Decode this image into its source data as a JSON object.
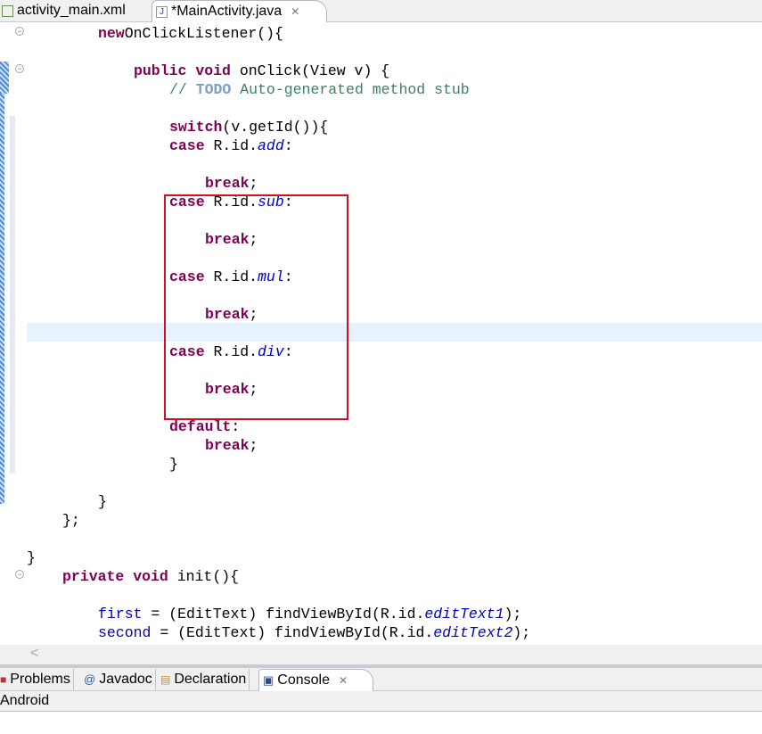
{
  "editor_tabs": [
    {
      "label": "activity_main.xml",
      "icon": "xml-file-icon"
    },
    {
      "label": "*MainActivity.java",
      "icon": "java-file-warning-icon",
      "active": true
    }
  ],
  "code_lines": [
    {
      "indent": 8,
      "tokens": [
        [
          "kw",
          "new"
        ],
        [
          "",
          "OnClickListener(){"
        ]
      ]
    },
    {
      "indent": 0,
      "tokens": []
    },
    {
      "indent": 12,
      "tokens": [
        [
          "kw",
          "public"
        ],
        [
          "",
          " "
        ],
        [
          "kw",
          "void"
        ],
        [
          "",
          " onClick(View v) {"
        ]
      ]
    },
    {
      "indent": 16,
      "tokens": [
        [
          "cm",
          "// "
        ],
        [
          "todo",
          "TODO"
        ],
        [
          "cm",
          " Auto-generated method stub"
        ]
      ]
    },
    {
      "indent": 0,
      "tokens": []
    },
    {
      "indent": 16,
      "tokens": [
        [
          "kw",
          "switch"
        ],
        [
          "",
          "(v.getId()){"
        ]
      ]
    },
    {
      "indent": 16,
      "tokens": [
        [
          "kw",
          "case"
        ],
        [
          "",
          " R.id."
        ],
        [
          "sfld",
          "add"
        ],
        [
          "",
          ":"
        ]
      ]
    },
    {
      "indent": 0,
      "tokens": []
    },
    {
      "indent": 20,
      "tokens": [
        [
          "kw",
          "break"
        ],
        [
          "",
          ";"
        ]
      ]
    },
    {
      "indent": 16,
      "tokens": [
        [
          "kw",
          "case"
        ],
        [
          "",
          " R.id."
        ],
        [
          "sfld",
          "sub"
        ],
        [
          "",
          ":"
        ]
      ]
    },
    {
      "indent": 0,
      "tokens": []
    },
    {
      "indent": 20,
      "tokens": [
        [
          "kw",
          "break"
        ],
        [
          "",
          ";"
        ]
      ]
    },
    {
      "indent": 0,
      "tokens": []
    },
    {
      "indent": 16,
      "tokens": [
        [
          "kw",
          "case"
        ],
        [
          "",
          " R.id."
        ],
        [
          "sfld",
          "mul"
        ],
        [
          "",
          ":"
        ]
      ]
    },
    {
      "indent": 0,
      "tokens": []
    },
    {
      "indent": 20,
      "tokens": [
        [
          "kw",
          "break"
        ],
        [
          "",
          ";"
        ]
      ]
    },
    {
      "indent": 0,
      "tokens": []
    },
    {
      "indent": 16,
      "tokens": [
        [
          "kw",
          "case"
        ],
        [
          "",
          " R.id."
        ],
        [
          "sfld",
          "div"
        ],
        [
          "",
          ":"
        ]
      ]
    },
    {
      "indent": 0,
      "tokens": []
    },
    {
      "indent": 20,
      "tokens": [
        [
          "kw",
          "break"
        ],
        [
          "",
          ";"
        ]
      ]
    },
    {
      "indent": 0,
      "tokens": []
    },
    {
      "indent": 16,
      "tokens": [
        [
          "kw",
          "default"
        ],
        [
          "",
          ":"
        ]
      ]
    },
    {
      "indent": 20,
      "tokens": [
        [
          "kw",
          "break"
        ],
        [
          "",
          ";"
        ]
      ]
    },
    {
      "indent": 16,
      "tokens": [
        [
          "",
          "}"
        ]
      ]
    },
    {
      "indent": 0,
      "tokens": []
    },
    {
      "indent": 8,
      "tokens": [
        [
          "",
          "}"
        ]
      ]
    },
    {
      "indent": 4,
      "tokens": [
        [
          "",
          "};"
        ]
      ]
    },
    {
      "indent": 0,
      "tokens": []
    },
    {
      "indent": 0,
      "tokens": [
        [
          "",
          "}"
        ]
      ]
    },
    {
      "indent": 4,
      "tokens": [
        [
          "kw",
          "private"
        ],
        [
          "",
          " "
        ],
        [
          "kw",
          "void"
        ],
        [
          "",
          " init(){"
        ]
      ]
    },
    {
      "indent": 0,
      "tokens": []
    },
    {
      "indent": 8,
      "tokens": [
        [
          "fld",
          "first"
        ],
        [
          "",
          " = (EditText) findViewById(R.id."
        ],
        [
          "sfld",
          "editText1"
        ],
        [
          "",
          ");"
        ]
      ]
    },
    {
      "indent": 8,
      "tokens": [
        [
          "fld",
          "second"
        ],
        [
          "",
          " = (EditText) findViewById(R.id."
        ],
        [
          "sfld",
          "editText2"
        ],
        [
          "",
          ");"
        ]
      ]
    }
  ],
  "panel_tabs": [
    {
      "label": "Problems",
      "icon": "problems-icon"
    },
    {
      "label": "Javadoc",
      "icon": "at-icon"
    },
    {
      "label": "Declaration",
      "icon": "declaration-icon"
    },
    {
      "label": "Console",
      "icon": "console-icon",
      "active": true
    }
  ],
  "console_title": "Android",
  "colors": {
    "keyword": "#7f0055",
    "comment": "#3f7f5f",
    "field": "#0000c0",
    "highlight": "#e8f2fe",
    "annotation_box": "#d0101c"
  }
}
